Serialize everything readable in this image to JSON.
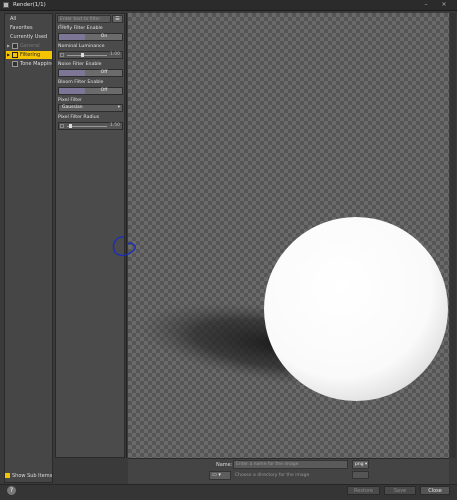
{
  "window": {
    "title": "Render(1/1)",
    "minimize": "–",
    "close": "×"
  },
  "sidebar": {
    "items": [
      {
        "label": "All"
      },
      {
        "label": "Favorites"
      },
      {
        "label": "Currently Used"
      },
      {
        "label": "General"
      },
      {
        "label": "Filtering"
      },
      {
        "label": "Tone Mapping"
      }
    ],
    "selected": "Filtering",
    "show_sub_items": "Show Sub Items"
  },
  "filter": {
    "placeholder": "Enter text to filter by...",
    "menu_icon": "☰"
  },
  "properties": {
    "firefly": {
      "label": "Firefly Filter Enable",
      "value": "On"
    },
    "luminance": {
      "label": "Nominal Luminance",
      "value": "1.00"
    },
    "noise": {
      "label": "Noise Filter Enable",
      "value": "Off"
    },
    "bloom": {
      "label": "Bloom Filter Enable",
      "value": "Off"
    },
    "pixel_filter": {
      "label": "Pixel Filter",
      "value": "Gaussian"
    },
    "pixel_radius": {
      "label": "Pixel Filter Radius",
      "value": "1.50"
    }
  },
  "save": {
    "name_label": "Name:",
    "name_placeholder": "Enter a name for the image",
    "format": "png",
    "folder_icon": "folder-icon",
    "dir_hint": "Choose a directory for the image"
  },
  "footer": {
    "help": "?",
    "buttons": [
      "Restore",
      "Save",
      "Close"
    ]
  },
  "colors": {
    "accent": "#f5c400",
    "toggle": "#7e7697",
    "annotation": "#1a2fb4"
  }
}
